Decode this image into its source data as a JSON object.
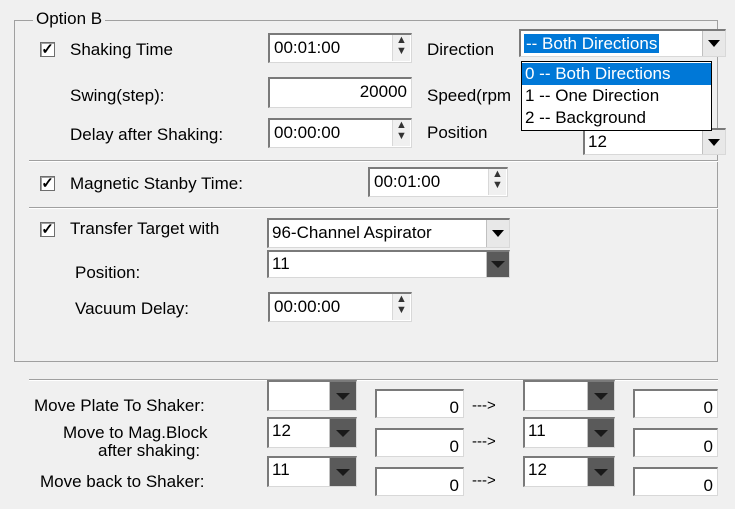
{
  "group": {
    "title": "Option B"
  },
  "shaking": {
    "checkbox_mark": "✓",
    "label": "Shaking Time",
    "time": "00:01:00",
    "direction_label": "Direction",
    "direction_value": "-- Both Directions",
    "swing_label": "Swing(step):",
    "swing_value": "20000",
    "speed_label": "Speed(rpm",
    "delay_label": "Delay after Shaking:",
    "delay_value": "00:00:00",
    "position_label": "Position",
    "position_value": "12"
  },
  "direction_dropdown": {
    "options": [
      "0 -- Both Directions",
      "1 -- One Direction",
      "2 -- Background"
    ],
    "highlighted_index": 0
  },
  "magnetic": {
    "checkbox_mark": "✓",
    "label": "Magnetic Stanby Time:",
    "time": "00:01:00"
  },
  "transfer": {
    "checkbox_mark": "✓",
    "label": "Transfer Target with",
    "target_value": "96-Channel Aspirator",
    "position_label": "Position:",
    "position_value": "11",
    "vacuum_label": "Vacuum Delay:",
    "vacuum_value": "00:00:00"
  },
  "moves": {
    "arrow": "--->",
    "rows": [
      {
        "label": "Move Plate To Shaker:",
        "label2": "",
        "from_pos": "",
        "from_offset": "0",
        "to_pos": "",
        "to_offset": "0"
      },
      {
        "label": "Move to Mag.Block",
        "label2": "after shaking:",
        "from_pos": "12",
        "from_offset": "0",
        "to_pos": "11",
        "to_offset": "0"
      },
      {
        "label": "Move back to Shaker:",
        "label2": "",
        "from_pos": "11",
        "from_offset": "0",
        "to_pos": "12",
        "to_offset": "0"
      }
    ]
  }
}
